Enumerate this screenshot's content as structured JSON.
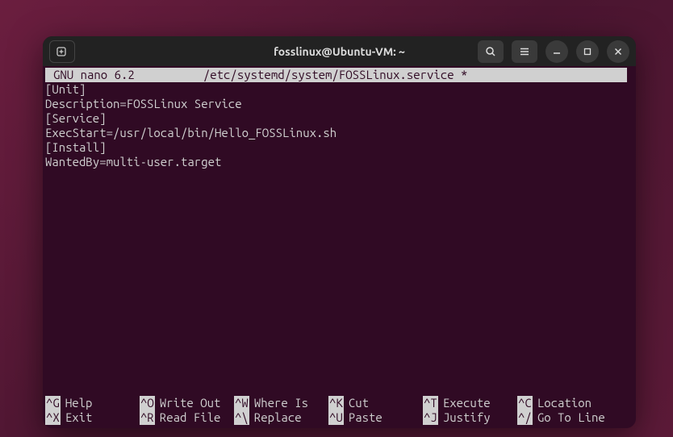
{
  "titlebar": {
    "title": "fosslinux@Ubuntu-VM: ~"
  },
  "nano": {
    "app": "GNU nano 6.2",
    "file": "/etc/systemd/system/FOSSLinux.service *",
    "content": "[Unit]\nDescription=FOSSLinux Service\n[Service]\nExecStart=/usr/local/bin/Hello_FOSSLinux.sh\n[Install]\nWantedBy=multi-user.target"
  },
  "footer": {
    "row1": [
      {
        "key": "^G",
        "label": "Help"
      },
      {
        "key": "^O",
        "label": "Write Out"
      },
      {
        "key": "^W",
        "label": "Where Is"
      },
      {
        "key": "^K",
        "label": "Cut"
      },
      {
        "key": "^T",
        "label": "Execute"
      },
      {
        "key": "^C",
        "label": "Location"
      }
    ],
    "row2": [
      {
        "key": "^X",
        "label": "Exit"
      },
      {
        "key": "^R",
        "label": "Read File"
      },
      {
        "key": "^\\",
        "label": "Replace"
      },
      {
        "key": "^U",
        "label": "Paste"
      },
      {
        "key": "^J",
        "label": "Justify"
      },
      {
        "key": "^/",
        "label": "Go To Line"
      }
    ]
  }
}
